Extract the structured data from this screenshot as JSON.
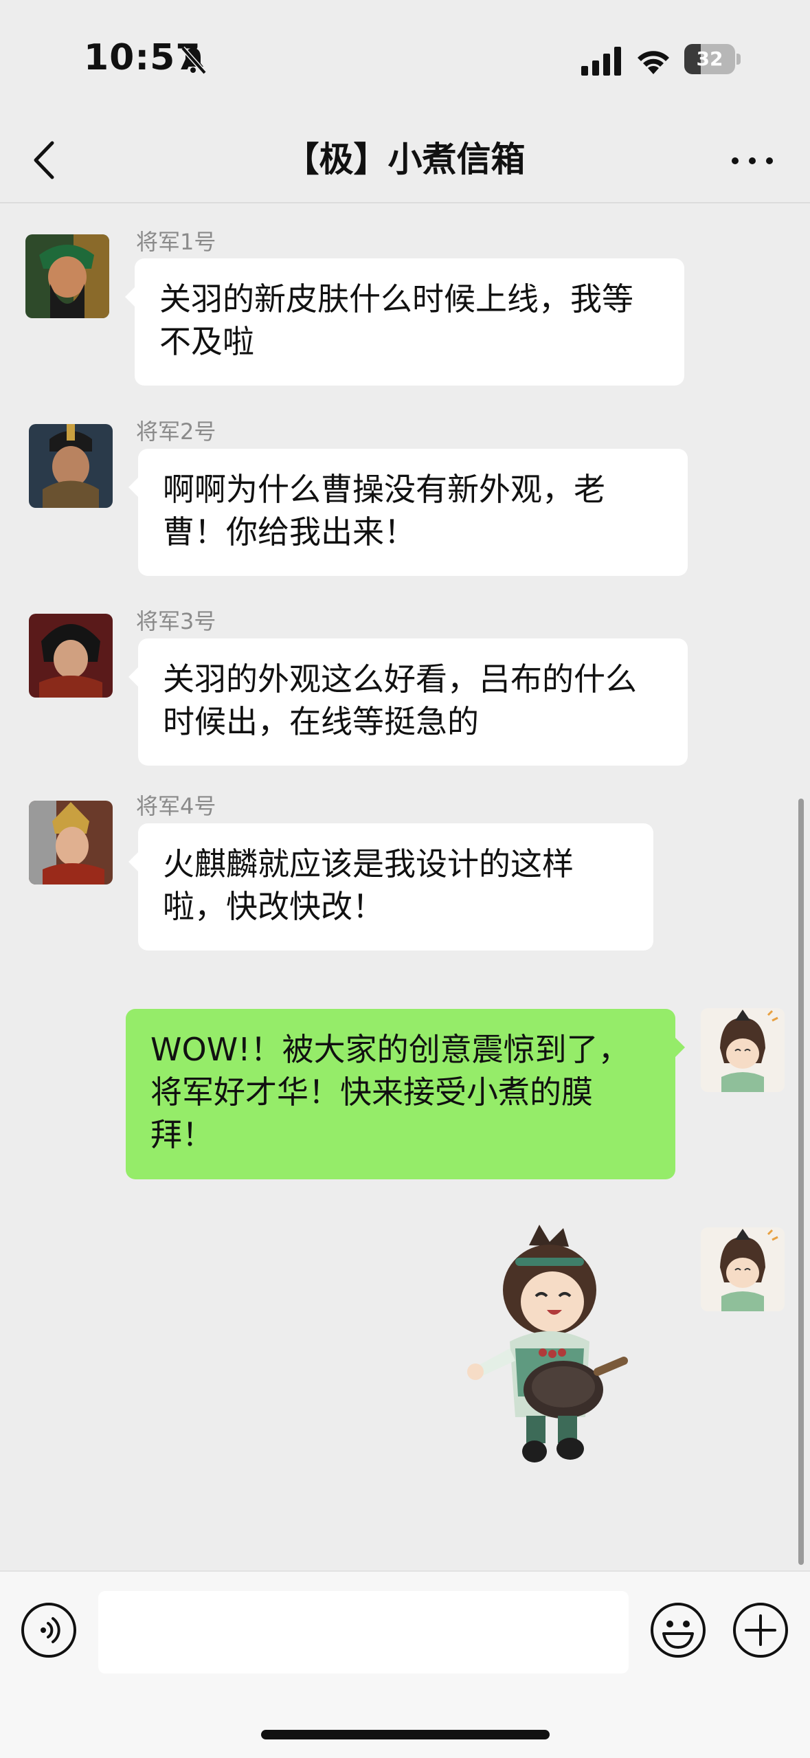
{
  "status_bar": {
    "time": "10:57",
    "battery": "32",
    "battery_level": 0.32
  },
  "nav": {
    "title": "【极】小煮信箱"
  },
  "messages": [
    {
      "sender": "将军1号",
      "text": "关羽的新皮肤什么时候上线，我等不及啦"
    },
    {
      "sender": "将军2号",
      "text": "啊啊为什么曹操没有新外观，老曹！你给我出来！"
    },
    {
      "sender": "将军3号",
      "text": "关羽的外观这么好看，吕布的什么时候出，在线等挺急的"
    },
    {
      "sender": "将军4号",
      "text": "火麒麟就应该是我设计的这样啦，快改快改！"
    },
    {
      "sender": "",
      "text": "WOW!！被大家的创意震惊到了，将军好才华！快来接受小煮的膜拜！"
    }
  ],
  "input": {
    "value": "",
    "placeholder": ""
  },
  "icons": {
    "back": "chevron-left-icon",
    "more": "more-dots-icon",
    "voice": "voice-icon",
    "emoji": "emoji-icon",
    "plus": "plus-icon"
  },
  "colors": {
    "my_bubble": "#95ec69",
    "their_bubble": "#ffffff",
    "background": "#ededed"
  }
}
